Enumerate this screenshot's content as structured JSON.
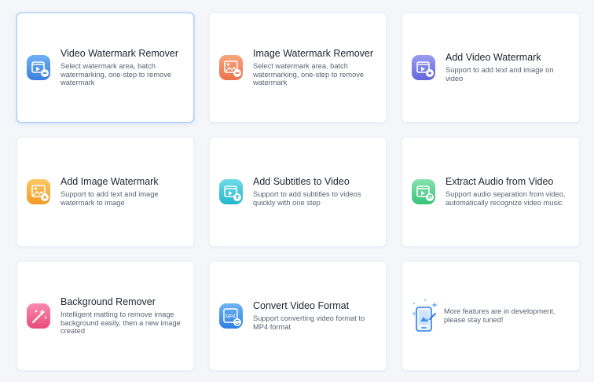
{
  "tools": [
    {
      "title": "Video Watermark Remover",
      "desc": "Select watermark area, batch watermarking, one-step to remove watermark",
      "icon": "video-remove-icon",
      "color": "#4a8fe8"
    },
    {
      "title": "Image Watermark Remover",
      "desc": "Select watermark area, batch watermarking, one-step to remove watermark",
      "icon": "image-remove-icon",
      "color": "#f0865e"
    },
    {
      "title": "Add Video Watermark",
      "desc": "Support to add text and image on video",
      "icon": "video-add-icon",
      "color": "#7b7ee6"
    },
    {
      "title": "Add Image Watermark",
      "desc": "Support to add text and image watermark to image",
      "icon": "image-add-icon",
      "color": "#f7ad3c"
    },
    {
      "title": "Add Subtitles to Video",
      "desc": "Support to add subtitles to videos quickly with one step",
      "icon": "subtitle-icon",
      "color": "#3cc8d8"
    },
    {
      "title": "Extract Audio from Video",
      "desc": "Support audio separation from video, automatically recognize video music",
      "icon": "audio-extract-icon",
      "color": "#52cf8c"
    },
    {
      "title": "Background Remover",
      "desc": "Intelligent matting to remove image background easily, then a new image created",
      "icon": "magic-wand-icon",
      "color": "#f05d8b"
    },
    {
      "title": "Convert Video Format",
      "desc": "Support converting video format to MP4 format",
      "icon": "mp4-convert-icon",
      "color": "#3b8fe6",
      "icon_label": "MP4"
    }
  ],
  "more": {
    "desc": "More features are in development, please stay tuned!",
    "icon": "phone-development-icon"
  }
}
